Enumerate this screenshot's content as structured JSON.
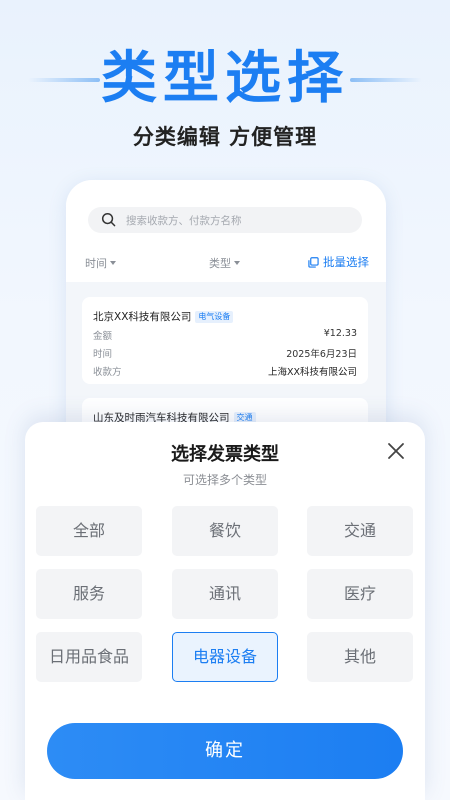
{
  "hero": {
    "title": "类型选择",
    "subtitle": "分类编辑 方便管理"
  },
  "phone": {
    "search_placeholder": "搜索收款方、付款方名称",
    "filters": {
      "time": "时间",
      "type": "类型"
    },
    "batch_label": "批量选择",
    "cards": [
      {
        "name": "北京XX科技有限公司",
        "tag": "电气设备",
        "amount_label": "金额",
        "amount": "¥12.33",
        "time_label": "时间",
        "time": "2025年6月23日",
        "payee_label": "收款方",
        "payee": "上海XX科技有限公司"
      },
      {
        "name": "山东及时雨汽车科技有限公司",
        "tag": "交通"
      }
    ]
  },
  "sheet": {
    "title": "选择发票类型",
    "subtitle": "可选择多个类型",
    "options": [
      "全部",
      "餐饮",
      "交通",
      "服务",
      "通讯",
      "医疗",
      "日用品食品",
      "电器设备",
      "其他"
    ],
    "selected": "电器设备",
    "confirm_label": "确定"
  },
  "colors": {
    "accent": "#1c7ef2",
    "option_bg": "#f3f4f6",
    "selected_bg": "#eaf3fe"
  },
  "icons": {
    "search": "search-icon",
    "batch": "batch-select-icon",
    "close": "close-icon"
  }
}
